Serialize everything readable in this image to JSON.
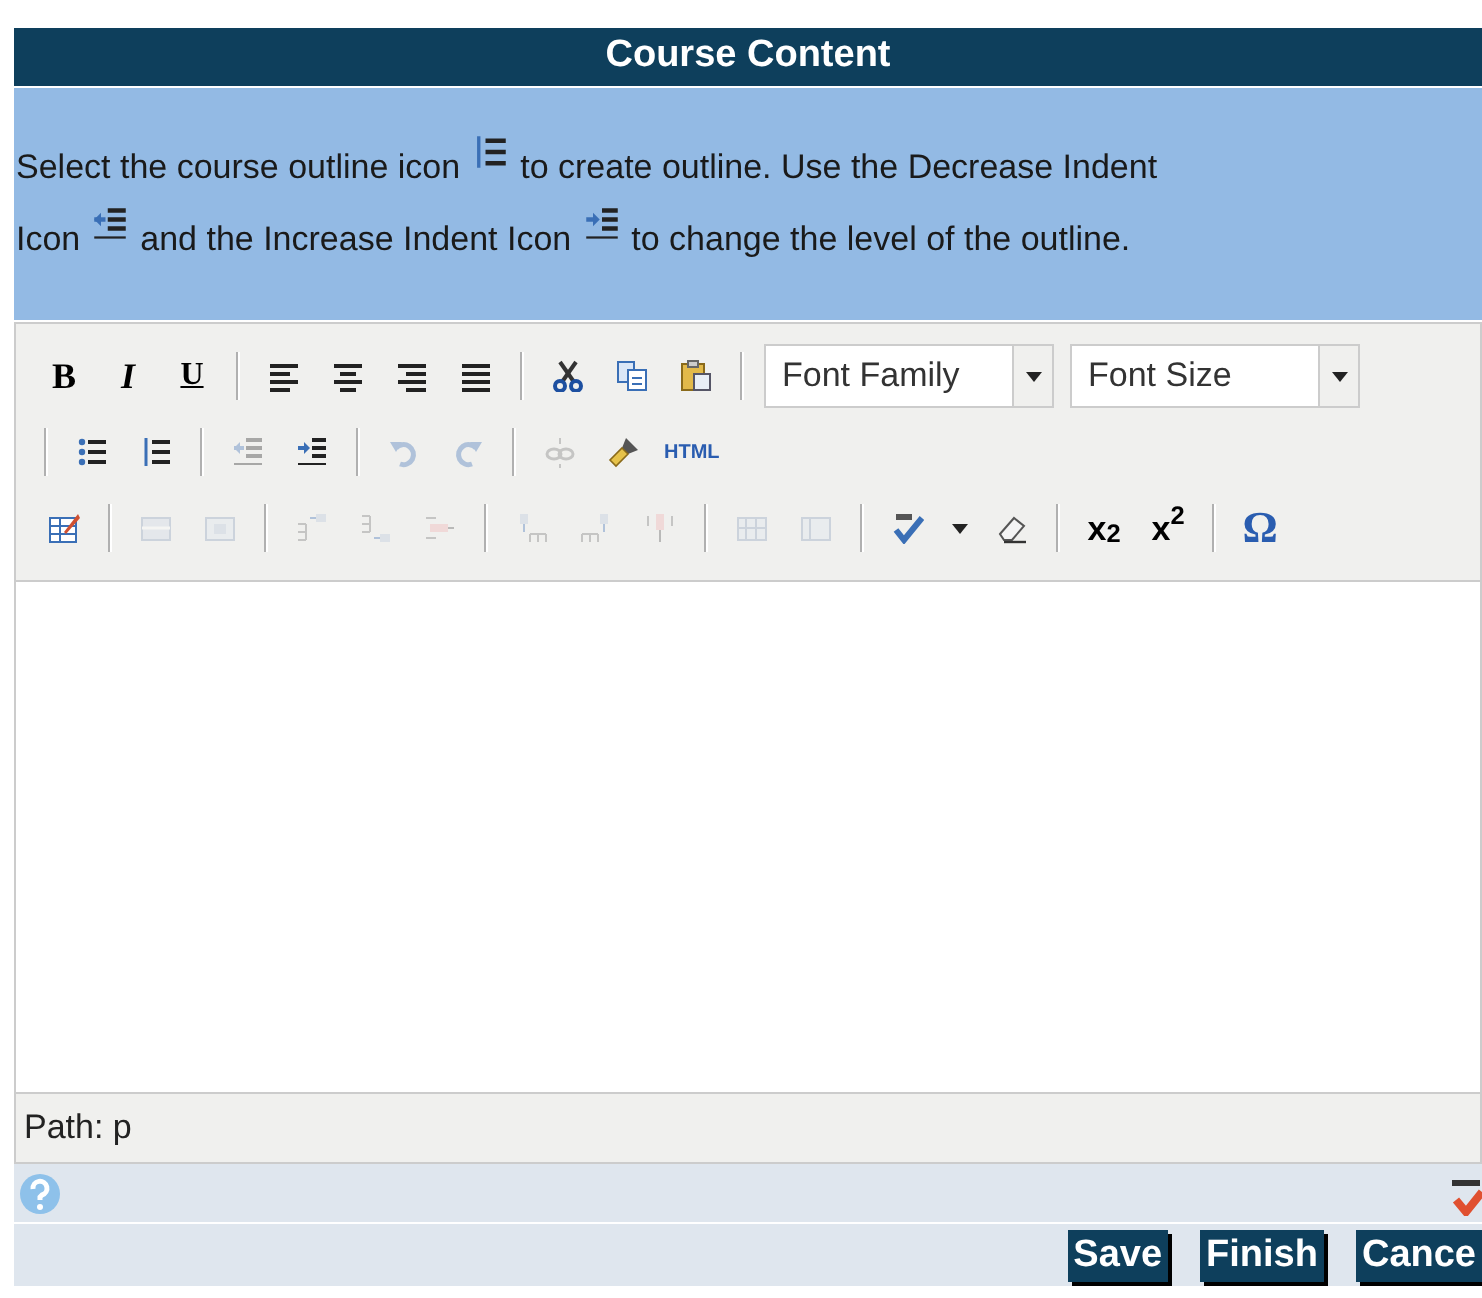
{
  "header": {
    "title": "Course Content"
  },
  "instructions": {
    "segments": [
      "Select the course outline icon",
      "to create outline. Use the Decrease Indent",
      "Icon",
      "and the Increase Indent Icon",
      "to change the level of the outline."
    ]
  },
  "toolbar": {
    "rows": [
      [
        {
          "kind": "glyph",
          "label": "B",
          "disabled": false
        },
        {
          "kind": "glyph",
          "label": "I",
          "disabled": false
        },
        {
          "kind": "glyph",
          "label": "U",
          "disabled": false
        },
        {
          "kind": "separator"
        },
        {
          "kind": "icon",
          "disabled": false
        },
        {
          "kind": "icon",
          "disabled": false
        },
        {
          "kind": "icon",
          "disabled": false
        },
        {
          "kind": "icon",
          "disabled": false
        },
        {
          "kind": "separator"
        },
        {
          "kind": "icon",
          "disabled": false
        },
        {
          "kind": "icon",
          "disabled": false
        },
        {
          "kind": "icon",
          "disabled": false
        },
        {
          "kind": "separator"
        },
        {
          "kind": "select",
          "value": "Font Family"
        },
        {
          "kind": "select",
          "value": "Font Size"
        }
      ],
      [
        {
          "kind": "separator"
        },
        {
          "kind": "icon",
          "disabled": false
        },
        {
          "kind": "icon",
          "disabled": false
        },
        {
          "kind": "separator"
        },
        {
          "kind": "icon",
          "disabled": true
        },
        {
          "kind": "icon",
          "disabled": false
        },
        {
          "kind": "separator"
        },
        {
          "kind": "icon",
          "disabled": true
        },
        {
          "kind": "icon",
          "disabled": true
        },
        {
          "kind": "separator"
        },
        {
          "kind": "icon",
          "disabled": true
        },
        {
          "kind": "icon",
          "disabled": false
        },
        {
          "kind": "text",
          "label": "HTML",
          "disabled": false
        }
      ],
      [
        {
          "kind": "icon",
          "disabled": false
        },
        {
          "kind": "separator"
        },
        {
          "kind": "icon",
          "disabled": true
        },
        {
          "kind": "icon",
          "disabled": true
        },
        {
          "kind": "separator"
        },
        {
          "kind": "icon",
          "disabled": true
        },
        {
          "kind": "icon",
          "disabled": true
        },
        {
          "kind": "icon",
          "disabled": true
        },
        {
          "kind": "separator"
        },
        {
          "kind": "icon",
          "disabled": true
        },
        {
          "kind": "icon",
          "disabled": true
        },
        {
          "kind": "icon",
          "disabled": true
        },
        {
          "kind": "separator"
        },
        {
          "kind": "icon",
          "disabled": true
        },
        {
          "kind": "icon",
          "disabled": true
        },
        {
          "kind": "separator"
        },
        {
          "kind": "icon",
          "disabled": false
        },
        {
          "kind": "icon",
          "disabled": false
        },
        {
          "kind": "icon",
          "disabled": false
        },
        {
          "kind": "separator"
        },
        {
          "kind": "glyph",
          "label": "x$_{2}$",
          "disabled": false
        },
        {
          "kind": "glyph",
          "label": "x$^{2}$",
          "disabled": false
        },
        {
          "kind": "separator"
        },
        {
          "kind": "glyph",
          "label": "Ω",
          "disabled": false
        }
      ]
    ]
  },
  "status_bar": {
    "path": "Path: p"
  },
  "buttons": [
    "Save",
    "Finish",
    "Cance"
  ]
}
